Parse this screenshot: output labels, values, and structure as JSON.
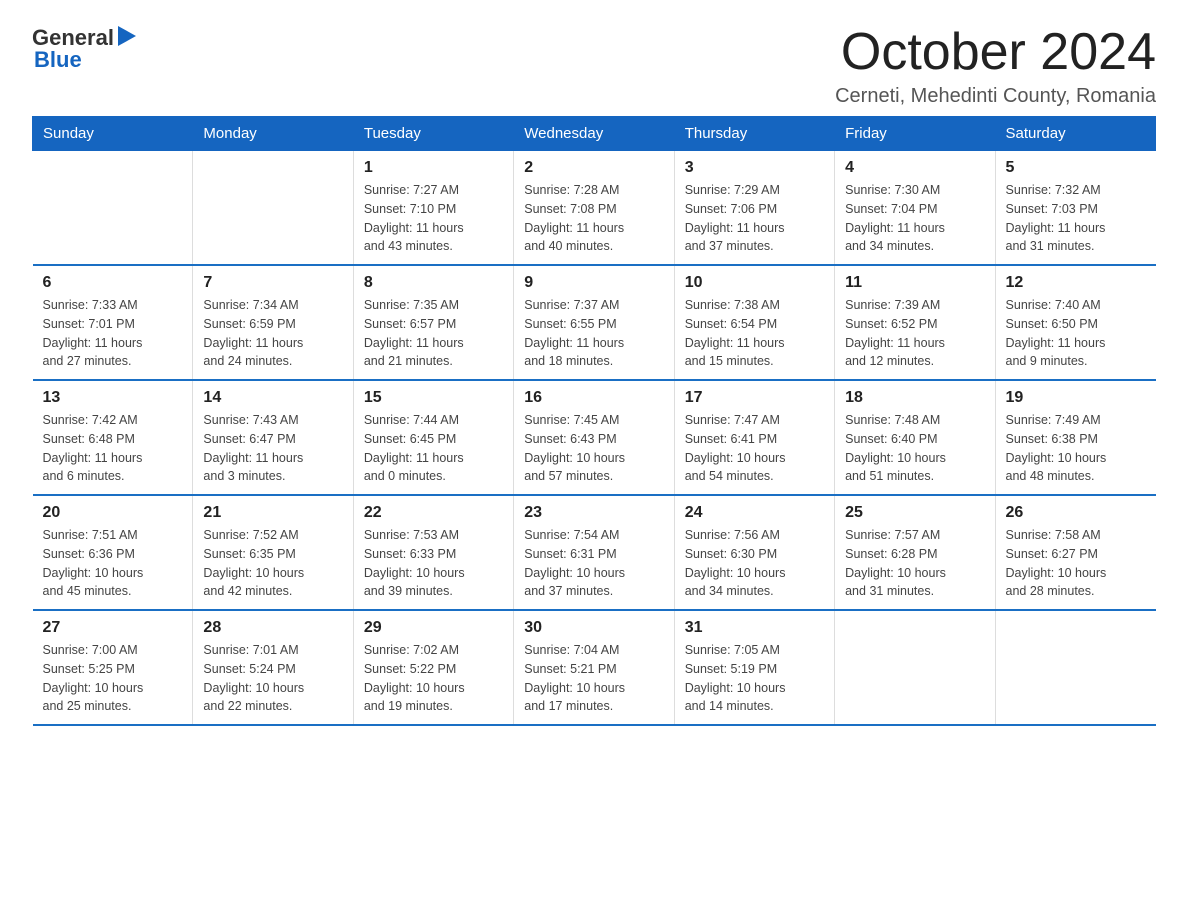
{
  "logo": {
    "text_general": "General",
    "text_blue": "Blue"
  },
  "title": "October 2024",
  "location": "Cerneti, Mehedinti County, Romania",
  "days_of_week": [
    "Sunday",
    "Monday",
    "Tuesday",
    "Wednesday",
    "Thursday",
    "Friday",
    "Saturday"
  ],
  "weeks": [
    [
      {
        "day": "",
        "info": ""
      },
      {
        "day": "",
        "info": ""
      },
      {
        "day": "1",
        "info": "Sunrise: 7:27 AM\nSunset: 7:10 PM\nDaylight: 11 hours\nand 43 minutes."
      },
      {
        "day": "2",
        "info": "Sunrise: 7:28 AM\nSunset: 7:08 PM\nDaylight: 11 hours\nand 40 minutes."
      },
      {
        "day": "3",
        "info": "Sunrise: 7:29 AM\nSunset: 7:06 PM\nDaylight: 11 hours\nand 37 minutes."
      },
      {
        "day": "4",
        "info": "Sunrise: 7:30 AM\nSunset: 7:04 PM\nDaylight: 11 hours\nand 34 minutes."
      },
      {
        "day": "5",
        "info": "Sunrise: 7:32 AM\nSunset: 7:03 PM\nDaylight: 11 hours\nand 31 minutes."
      }
    ],
    [
      {
        "day": "6",
        "info": "Sunrise: 7:33 AM\nSunset: 7:01 PM\nDaylight: 11 hours\nand 27 minutes."
      },
      {
        "day": "7",
        "info": "Sunrise: 7:34 AM\nSunset: 6:59 PM\nDaylight: 11 hours\nand 24 minutes."
      },
      {
        "day": "8",
        "info": "Sunrise: 7:35 AM\nSunset: 6:57 PM\nDaylight: 11 hours\nand 21 minutes."
      },
      {
        "day": "9",
        "info": "Sunrise: 7:37 AM\nSunset: 6:55 PM\nDaylight: 11 hours\nand 18 minutes."
      },
      {
        "day": "10",
        "info": "Sunrise: 7:38 AM\nSunset: 6:54 PM\nDaylight: 11 hours\nand 15 minutes."
      },
      {
        "day": "11",
        "info": "Sunrise: 7:39 AM\nSunset: 6:52 PM\nDaylight: 11 hours\nand 12 minutes."
      },
      {
        "day": "12",
        "info": "Sunrise: 7:40 AM\nSunset: 6:50 PM\nDaylight: 11 hours\nand 9 minutes."
      }
    ],
    [
      {
        "day": "13",
        "info": "Sunrise: 7:42 AM\nSunset: 6:48 PM\nDaylight: 11 hours\nand 6 minutes."
      },
      {
        "day": "14",
        "info": "Sunrise: 7:43 AM\nSunset: 6:47 PM\nDaylight: 11 hours\nand 3 minutes."
      },
      {
        "day": "15",
        "info": "Sunrise: 7:44 AM\nSunset: 6:45 PM\nDaylight: 11 hours\nand 0 minutes."
      },
      {
        "day": "16",
        "info": "Sunrise: 7:45 AM\nSunset: 6:43 PM\nDaylight: 10 hours\nand 57 minutes."
      },
      {
        "day": "17",
        "info": "Sunrise: 7:47 AM\nSunset: 6:41 PM\nDaylight: 10 hours\nand 54 minutes."
      },
      {
        "day": "18",
        "info": "Sunrise: 7:48 AM\nSunset: 6:40 PM\nDaylight: 10 hours\nand 51 minutes."
      },
      {
        "day": "19",
        "info": "Sunrise: 7:49 AM\nSunset: 6:38 PM\nDaylight: 10 hours\nand 48 minutes."
      }
    ],
    [
      {
        "day": "20",
        "info": "Sunrise: 7:51 AM\nSunset: 6:36 PM\nDaylight: 10 hours\nand 45 minutes."
      },
      {
        "day": "21",
        "info": "Sunrise: 7:52 AM\nSunset: 6:35 PM\nDaylight: 10 hours\nand 42 minutes."
      },
      {
        "day": "22",
        "info": "Sunrise: 7:53 AM\nSunset: 6:33 PM\nDaylight: 10 hours\nand 39 minutes."
      },
      {
        "day": "23",
        "info": "Sunrise: 7:54 AM\nSunset: 6:31 PM\nDaylight: 10 hours\nand 37 minutes."
      },
      {
        "day": "24",
        "info": "Sunrise: 7:56 AM\nSunset: 6:30 PM\nDaylight: 10 hours\nand 34 minutes."
      },
      {
        "day": "25",
        "info": "Sunrise: 7:57 AM\nSunset: 6:28 PM\nDaylight: 10 hours\nand 31 minutes."
      },
      {
        "day": "26",
        "info": "Sunrise: 7:58 AM\nSunset: 6:27 PM\nDaylight: 10 hours\nand 28 minutes."
      }
    ],
    [
      {
        "day": "27",
        "info": "Sunrise: 7:00 AM\nSunset: 5:25 PM\nDaylight: 10 hours\nand 25 minutes."
      },
      {
        "day": "28",
        "info": "Sunrise: 7:01 AM\nSunset: 5:24 PM\nDaylight: 10 hours\nand 22 minutes."
      },
      {
        "day": "29",
        "info": "Sunrise: 7:02 AM\nSunset: 5:22 PM\nDaylight: 10 hours\nand 19 minutes."
      },
      {
        "day": "30",
        "info": "Sunrise: 7:04 AM\nSunset: 5:21 PM\nDaylight: 10 hours\nand 17 minutes."
      },
      {
        "day": "31",
        "info": "Sunrise: 7:05 AM\nSunset: 5:19 PM\nDaylight: 10 hours\nand 14 minutes."
      },
      {
        "day": "",
        "info": ""
      },
      {
        "day": "",
        "info": ""
      }
    ]
  ]
}
